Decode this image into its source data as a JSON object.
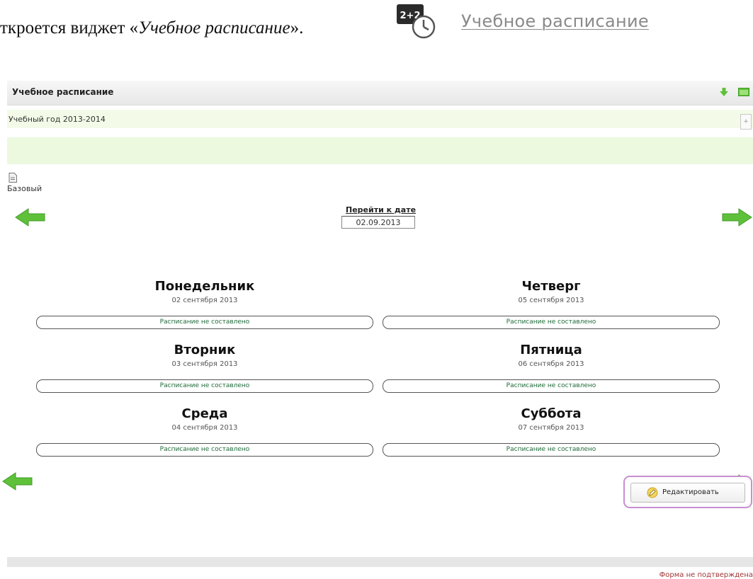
{
  "intro": {
    "text_before": "ткроется виджет «",
    "widget_name": "Учебное расписание",
    "text_after": "».",
    "icon": "clock-2plus2-icon",
    "icon_text": "2+2",
    "link_text": "Учебное расписание"
  },
  "widget": {
    "title": "Учебное расписание",
    "header_icons": [
      "green-down-arrow-icon",
      "green-window-icon"
    ],
    "school_year": "Учебный год 2013-2014",
    "strip_button": "+",
    "base_icon": "document-icon",
    "base_label": "Базовый",
    "goto_label": "Перейти к дате",
    "goto_value": "02.09.2013",
    "days": [
      {
        "name": "Понедельник",
        "date": "02 сентября 2013",
        "status": "Расписание не составлено"
      },
      {
        "name": "Четверг",
        "date": "05 сентября 2013",
        "status": "Расписание не составлено"
      },
      {
        "name": "Вторник",
        "date": "03 сентября 2013",
        "status": "Расписание не составлено"
      },
      {
        "name": "Пятница",
        "date": "06 сентября 2013",
        "status": "Расписание не составлено"
      },
      {
        "name": "Среда",
        "date": "04 сентября 2013",
        "status": "Расписание не составлено"
      },
      {
        "name": "Суббота",
        "date": "07 сентября 2013",
        "status": "Расписание не составлено"
      }
    ],
    "edit_button": "Редактировать",
    "footer_status": "Форма не подтверждена",
    "colors": {
      "accent_green": "#5fc13a",
      "status_green": "#1f6b3a",
      "edit_border": "#c78fd0",
      "footer_text": "#9e3434"
    }
  }
}
